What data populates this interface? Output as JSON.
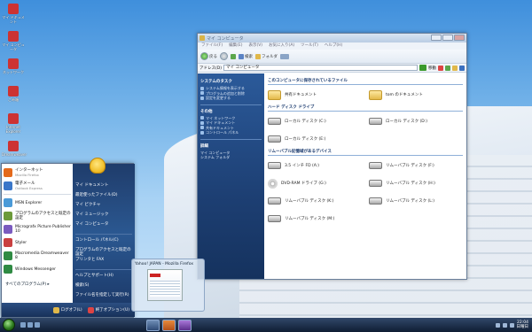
{
  "desktop": {
    "icons": [
      {
        "label": "マイ ドキュメント",
        "color": "#c33"
      },
      {
        "label": "マイ コンピュータ",
        "color": "#c33"
      },
      {
        "label": "ネットワーク",
        "color": "#c33"
      },
      {
        "label": "ごみ箱",
        "color": "#c33"
      },
      {
        "label": "Internet Explorer",
        "color": "#c33"
      },
      {
        "label": "Dreamweaver",
        "color": "#c33"
      }
    ]
  },
  "window": {
    "title": "マイ コンピュータ",
    "menu": [
      "ファイル(F)",
      "編集(E)",
      "表示(V)",
      "お気に入り(A)",
      "ツール(T)",
      "ヘルプ(H)"
    ],
    "toolbar": {
      "back": "戻る",
      "search": "検索",
      "folders": "フォルダ"
    },
    "address_label": "アドレス(D)",
    "address_value": "マイ コンピュータ",
    "go_label": "移動",
    "tasks": {
      "system_title": "システムのタスク",
      "system_items": [
        "システム情報を表示する",
        "プログラムの追加と削除",
        "設定を変更する"
      ],
      "other_title": "その他",
      "other_items": [
        "マイ ネットワーク",
        "マイ ドキュメント",
        "共有ドキュメント",
        "コントロール パネル"
      ],
      "detail_title": "詳細",
      "detail_name": "マイ コンピュータ",
      "detail_sub": "システム フォルダ"
    },
    "groups": [
      {
        "title": "このコンピュータに保存されているファイル",
        "items": [
          {
            "name": "共有ドキュメント",
            "kind": "folder"
          },
          {
            "name": "tom のドキュメント",
            "kind": "folder"
          }
        ]
      },
      {
        "title": "ハード ディスク ドライブ",
        "items": [
          {
            "name": "ローカル ディスク (C:)",
            "kind": "drive"
          },
          {
            "name": "ローカル ディスク (D:)",
            "kind": "drive"
          },
          {
            "name": "ローカル ディスク (E:)",
            "kind": "drive"
          }
        ]
      },
      {
        "title": "リムーバブル記憶域があるデバイス",
        "items": [
          {
            "name": "3.5 インチ FD (A:)",
            "kind": "drive"
          },
          {
            "name": "リムーバブル ディスク (F:)",
            "kind": "drive"
          },
          {
            "name": "DVD-RAM ドライブ (G:)",
            "kind": "cd"
          },
          {
            "name": "リムーバブル ディスク (H:)",
            "kind": "drive"
          },
          {
            "name": "リムーバブル ディスク (K:)",
            "kind": "drive"
          },
          {
            "name": "リムーバブル ディスク (L:)",
            "kind": "drive"
          },
          {
            "name": "リムーバブル ディスク (M:)",
            "kind": "drive"
          }
        ]
      }
    ]
  },
  "start_menu": {
    "pinned": [
      {
        "title": "インターネット",
        "sub": "Mozilla Firefox",
        "color": "#e46a1c"
      },
      {
        "title": "電子メール",
        "sub": "Outlook Express",
        "color": "#3b77c9"
      }
    ],
    "recent": [
      {
        "title": "MSN Explorer",
        "color": "#4a9ad8"
      },
      {
        "title": "プログラムのアクセスと既定の設定",
        "color": "#6c9a3a"
      },
      {
        "title": "Micrografx Picture Publisher 10",
        "color": "#7a5bbf"
      },
      {
        "title": "Styler",
        "color": "#c94040"
      },
      {
        "title": "Macromedia Dreamweaver 8",
        "color": "#2f8a43"
      },
      {
        "title": "Windows Messenger",
        "color": "#2f8a43"
      }
    ],
    "all_programs": "すべてのプログラム(P)",
    "right": [
      "マイ ドキュメント",
      "最近使ったファイル(D)",
      "マイ ピクチャ",
      "マイ ミュージック",
      "マイ コンピュータ",
      "コントロール パネル(C)",
      "プログラムのアクセスと既定の設定",
      "プリンタと FAX",
      "ヘルプとサポート(H)",
      "検索(S)",
      "ファイル名を指定して実行(R)"
    ],
    "logoff": "ログオフ(L)",
    "shutdown": "終了オプション(U)"
  },
  "thumbnail": {
    "title": "Yahoo! JAPAN - Mozilla Firefox"
  },
  "taskbar": {
    "time": "22:04",
    "day": "日曜日"
  }
}
